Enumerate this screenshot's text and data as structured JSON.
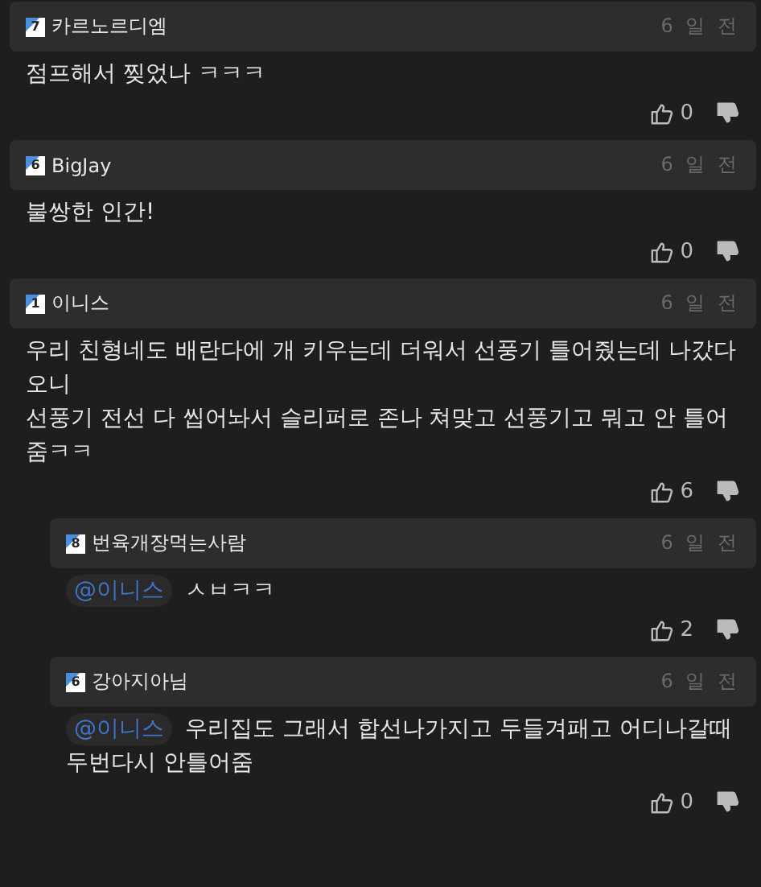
{
  "comments": [
    {
      "level": "7",
      "author": "카르노르디엠",
      "time": "6 일 전",
      "text": "점프해서 찢었나 ㅋㅋㅋ",
      "likes": "0"
    },
    {
      "level": "6",
      "author": "BigJay",
      "time": "6 일 전",
      "text": "불쌍한 인간!",
      "likes": "0"
    },
    {
      "level": "1",
      "author": "이니스",
      "time": "6 일 전",
      "text": "우리 친형네도 배란다에 개 키우는데 더워서 선풍기 틀어줬는데 나갔다오니\n선풍기 전선 다 씹어놔서 슬리퍼로 존나 쳐맞고 선풍기고 뭐고 안 틀어줌ㅋㅋ",
      "likes": "6",
      "replies": [
        {
          "level": "8",
          "author": "번육개장먹는사람",
          "time": "6 일 전",
          "mention": "@이니스",
          "text": "ㅅㅂㅋㅋ",
          "likes": "2"
        },
        {
          "level": "6",
          "author": "강아지아님",
          "time": "6 일 전",
          "mention": "@이니스",
          "text": "우리집도 그래서 합선나가지고 두들겨패고 어디나갈때 두번다시 안틀어줌",
          "likes": "0"
        }
      ]
    }
  ]
}
